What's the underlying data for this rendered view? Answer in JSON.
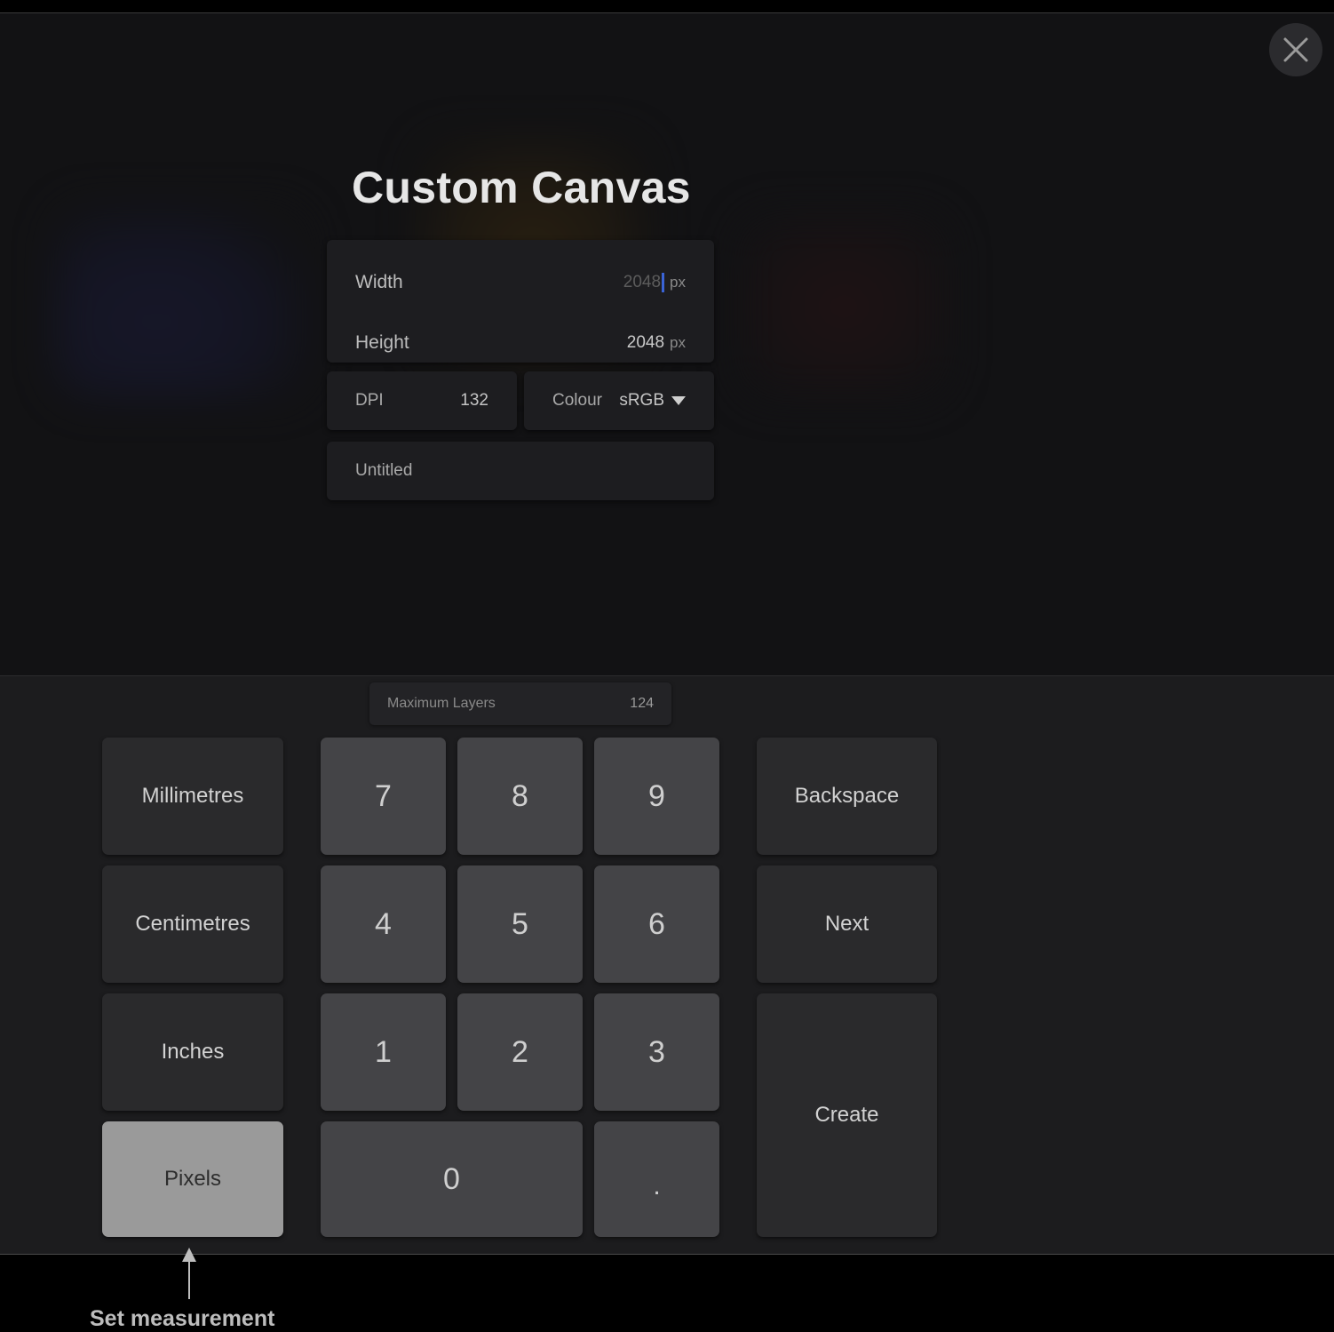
{
  "dialog": {
    "title": "Custom Canvas",
    "width": {
      "label": "Width",
      "value": "2048",
      "unit": "px"
    },
    "height": {
      "label": "Height",
      "value": "2048",
      "unit": "px"
    },
    "dpi": {
      "label": "DPI",
      "value": "132"
    },
    "colour": {
      "label": "Colour",
      "value": "sRGB"
    },
    "name": {
      "placeholder": "Untitled"
    }
  },
  "max_layers": {
    "label": "Maximum Layers",
    "value": "124"
  },
  "keypad": {
    "units": [
      "Millimetres",
      "Centimetres",
      "Inches",
      "Pixels"
    ],
    "selected_unit": "Pixels",
    "digits": [
      "7",
      "8",
      "9",
      "4",
      "5",
      "6",
      "1",
      "2",
      "3",
      "0",
      "."
    ],
    "backspace_label": "Backspace",
    "next_label": "Next",
    "create_label": "Create"
  },
  "annotation": {
    "caption": "Set measurement"
  },
  "icons": {
    "close": "close-icon",
    "dropdown": "dropdown-arrow-icon"
  },
  "colors": {
    "caret": "#3a63d6",
    "selected_key": "#9a9a9a"
  }
}
